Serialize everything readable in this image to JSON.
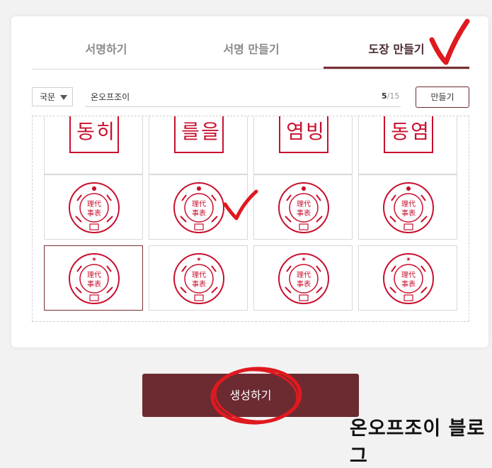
{
  "tabs": [
    {
      "label": "서명하기",
      "active": false
    },
    {
      "label": "서명 만들기",
      "active": false
    },
    {
      "label": "도장 만들기",
      "active": true
    }
  ],
  "form": {
    "language": "국문",
    "name_value": "온오프조이",
    "count_current": "5",
    "count_max": "/15",
    "make_label": "만들기"
  },
  "stamps": {
    "round_center_chars": "理代\n事表",
    "square_rows": [
      [
        "동",
        "히"
      ],
      [
        "를",
        "을"
      ],
      [
        "염",
        "빙"
      ],
      [
        "동",
        "염"
      ]
    ],
    "selected_index": 8
  },
  "create_button": {
    "label": "생성하기"
  },
  "watermark": "온오프조이 블로그",
  "colors": {
    "accent": "#6b2b31",
    "stamp_red": "#c8102e",
    "marker_red": "#e0191f"
  }
}
